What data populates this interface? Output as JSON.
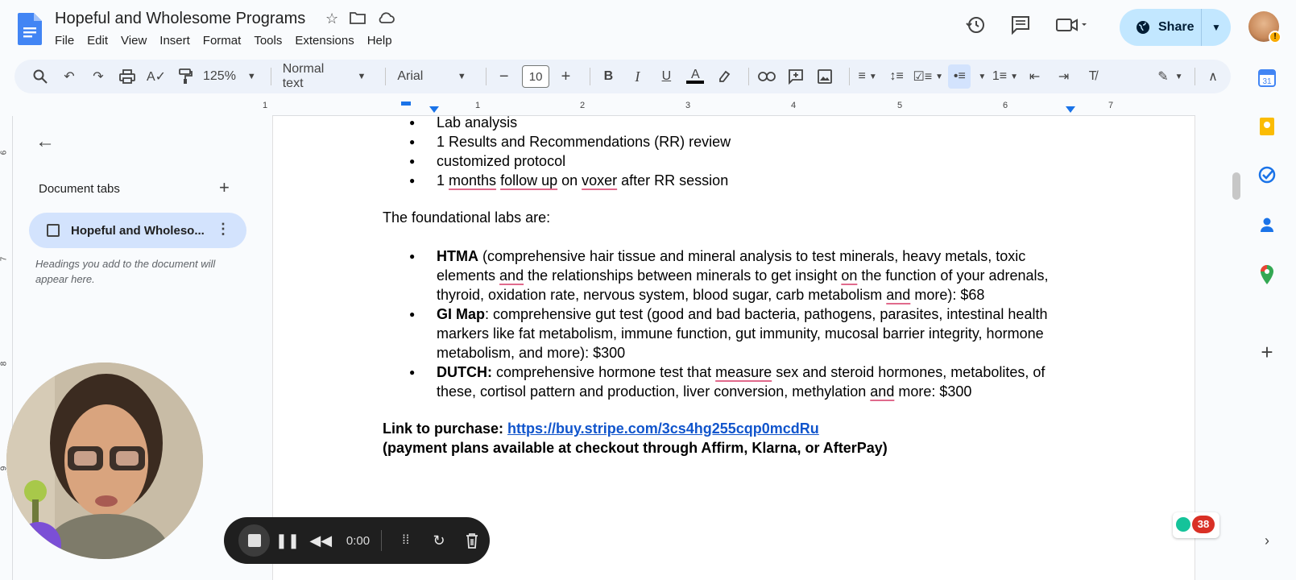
{
  "app": {
    "doc_title": "Hopeful and Wholesome Programs",
    "menu": [
      "File",
      "Edit",
      "View",
      "Insert",
      "Format",
      "Tools",
      "Extensions",
      "Help"
    ],
    "share_label": "Share",
    "colors": {
      "share_bg": "#c2e7ff",
      "tab_active": "#d3e3fd",
      "link": "#1155cc",
      "spell": "#e06a8c"
    }
  },
  "toolbar": {
    "zoom": "125%",
    "style": "Normal text",
    "font": "Arial",
    "font_size": "10"
  },
  "ruler": {
    "numbers": [
      "1",
      "1",
      "2",
      "3",
      "4",
      "5",
      "6",
      "7"
    ]
  },
  "vruler": {
    "numbers": [
      "6",
      "7",
      "8",
      "9"
    ]
  },
  "sidebar": {
    "tabs_label": "Document tabs",
    "active_tab": "Hopeful and Wholeso...",
    "hint": "Headings you add to the document will appear here."
  },
  "doc": {
    "list1": {
      "i0": "Lab analysis",
      "i1": "1 Results and Recommendations (RR) review",
      "i2": "customized protocol",
      "i3_a": "1 ",
      "i3_b": "months",
      "i3_c": " ",
      "i3_d": "follow up",
      "i3_e": " on ",
      "i3_f": "voxer",
      "i3_g": " after RR session"
    },
    "foundational": "The foundational labs are:",
    "htma": {
      "label": "HTMA",
      "l1": " (comprehensive hair tissue and mineral analysis to test minerals, heavy metals, toxic",
      "l2_a": "elements ",
      "l2_b": "and",
      "l2_c": " the relationships between minerals to get insight ",
      "l2_d": "on",
      "l2_e": " the function of your adrenals,",
      "l3_a": "thyroid, oxidation rate, nervous system, blood sugar, carb metabolism ",
      "l3_b": "and",
      "l3_c": " more): $68"
    },
    "gimap": {
      "label": "GI Map",
      "l1": ": comprehensive gut test (good and bad bacteria, pathogens, parasites, intestinal health",
      "l2": "markers like fat metabolism, immune function, gut immunity, mucosal barrier integrity, hormone",
      "l3": "metabolism, and more): $300"
    },
    "dutch": {
      "label": "DUTCH:",
      "l1_a": " comprehensive hormone test that ",
      "l1_b": "measure",
      "l1_c": " sex and steroid hormones, metabolites, of",
      "l2_a": "these, cortisol pattern and production, liver conversion, methylation ",
      "l2_b": "and",
      "l2_c": " more: $300"
    },
    "purchase_label": "Link to purchase: ",
    "purchase_url": "https://buy.stripe.com/3cs4hg255cqp0mcdRu",
    "payment_note": "(payment plans available at checkout through Affirm, Klarna, or AfterPay)"
  },
  "recorder": {
    "time": "0:00"
  },
  "grammarly": {
    "count": "38"
  }
}
